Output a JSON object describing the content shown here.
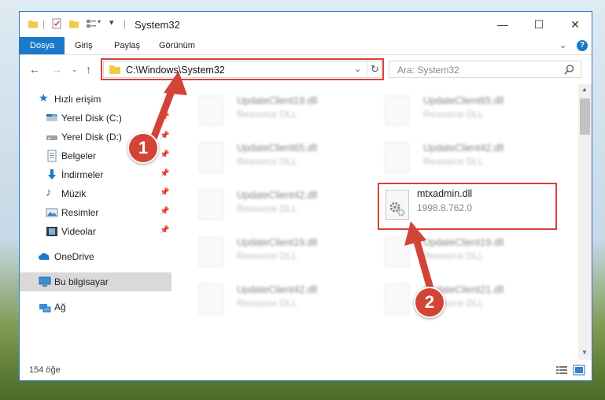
{
  "window": {
    "title": "System32",
    "controls": {
      "minimize": "—",
      "maximize": "☐",
      "close": "✕"
    }
  },
  "ribbon": {
    "tabs": [
      {
        "label": "Dosya",
        "active": true
      },
      {
        "label": "Giriş"
      },
      {
        "label": "Paylaş"
      },
      {
        "label": "Görünüm"
      }
    ]
  },
  "address_bar": {
    "path": "C:\\Windows\\System32"
  },
  "search": {
    "placeholder": "Ara: System32"
  },
  "sidebar": {
    "quick_access": "Hızlı erişim",
    "items": [
      {
        "label": "Yerel Disk (C:)",
        "icon": "drive-icon",
        "pinned": true
      },
      {
        "label": "Yerel Disk (D:)",
        "icon": "drive-icon",
        "pinned": true
      },
      {
        "label": "Belgeler",
        "icon": "documents-icon",
        "pinned": true
      },
      {
        "label": "İndirmeler",
        "icon": "downloads-icon",
        "pinned": true
      },
      {
        "label": "Müzik",
        "icon": "music-icon",
        "pinned": true
      },
      {
        "label": "Resimler",
        "icon": "pictures-icon",
        "pinned": true
      },
      {
        "label": "Videolar",
        "icon": "videos-icon",
        "pinned": true
      }
    ],
    "onedrive": "OneDrive",
    "this_pc": "Bu bilgisayar",
    "network": "Ağ"
  },
  "files": [
    {
      "name": "UpdateClient19.dll",
      "desc": "Resource DLL"
    },
    {
      "name": "UpdateClient65.dll",
      "desc": "Resource DLL"
    },
    {
      "name": "UpdateClient65.dll",
      "desc": "Resource DLL"
    },
    {
      "name": "UpdateClient42.dll",
      "desc": "Resource DLL"
    },
    {
      "name": "UpdateClient42.dll",
      "desc": "Resource DLL"
    },
    {
      "name": "mtxadmin.dll",
      "desc": "1998.8.762.0"
    },
    {
      "name": "UpdateClient19.dll",
      "desc": "Resource DLL"
    },
    {
      "name": "UpdateClient19.dll",
      "desc": "Resource DLL"
    },
    {
      "name": "UpdateClient42.dll",
      "desc": "Resource DLL"
    },
    {
      "name": "UpdateClient21.dll",
      "desc": "Resource DLL"
    }
  ],
  "status": {
    "count": "154 öğe"
  },
  "annotations": {
    "badge1": "1",
    "badge2": "2"
  },
  "colors": {
    "accent": "#1979ca",
    "highlight": "#d9423a",
    "badge": "#d24437"
  }
}
